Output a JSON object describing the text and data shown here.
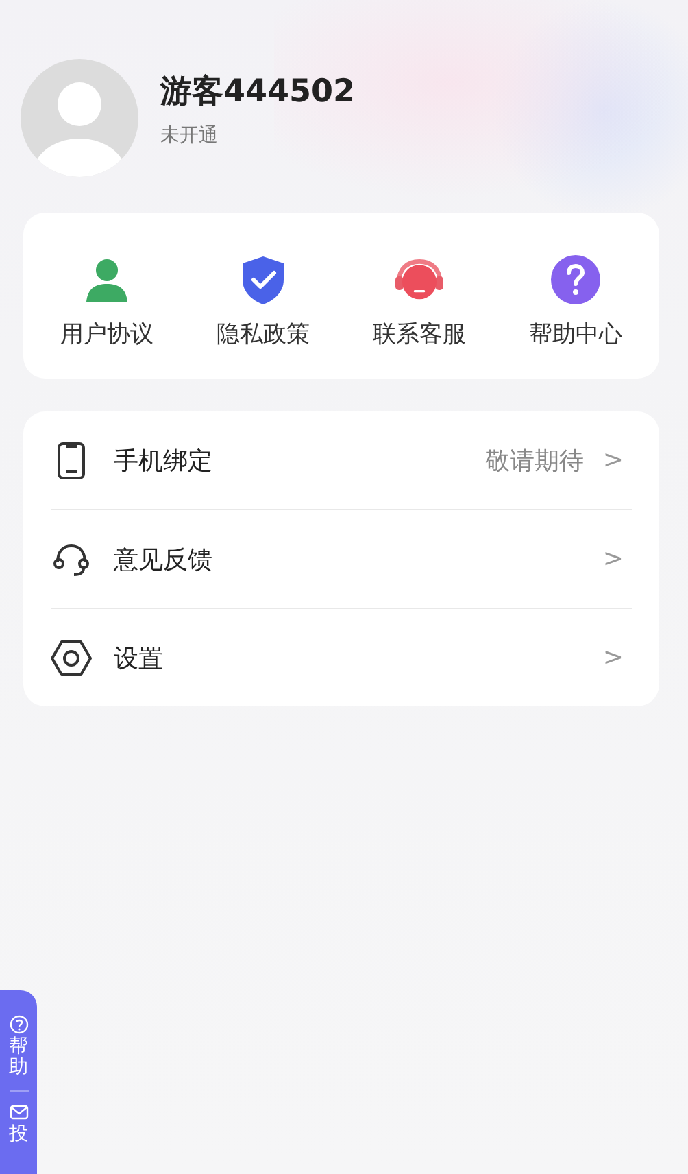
{
  "profile": {
    "name": "游客444502",
    "status": "未开通"
  },
  "shortcuts": [
    {
      "kind": "agreement",
      "label": "用户协议"
    },
    {
      "kind": "privacy",
      "label": "隐私政策"
    },
    {
      "kind": "service",
      "label": "联系客服"
    },
    {
      "kind": "help",
      "label": "帮助中心"
    }
  ],
  "menu": [
    {
      "kind": "phone",
      "label": "手机绑定",
      "value": "敬请期待",
      "chevron": ">"
    },
    {
      "kind": "feedback",
      "label": "意见反馈",
      "chevron": ">"
    },
    {
      "kind": "settings",
      "label": "设置",
      "chevron": ">"
    }
  ],
  "side_tab": [
    {
      "kind": "help",
      "label": "帮助"
    },
    {
      "kind": "mail",
      "label": "投"
    }
  ]
}
